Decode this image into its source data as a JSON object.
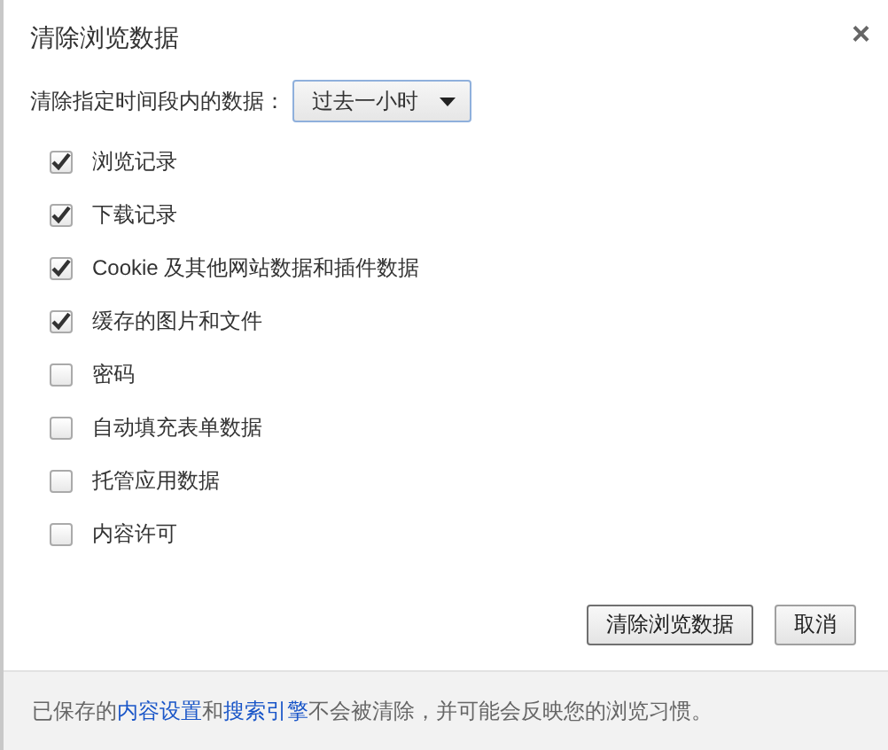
{
  "dialog": {
    "title": "清除浏览数据",
    "close_label": "×"
  },
  "time_range": {
    "label": "清除指定时间段内的数据：",
    "value": "过去一小时"
  },
  "options": [
    {
      "label": "浏览记录",
      "checked": true
    },
    {
      "label": "下载记录",
      "checked": true
    },
    {
      "label": "Cookie 及其他网站数据和插件数据",
      "checked": true
    },
    {
      "label": "缓存的图片和文件",
      "checked": true
    },
    {
      "label": "密码",
      "checked": false
    },
    {
      "label": "自动填充表单数据",
      "checked": false
    },
    {
      "label": "托管应用数据",
      "checked": false
    },
    {
      "label": "内容许可",
      "checked": false
    }
  ],
  "buttons": [
    {
      "label": "清除浏览数据",
      "kind": "primary"
    },
    {
      "label": "取消",
      "kind": "cancel"
    }
  ],
  "footer": [
    {
      "text": "已保存的",
      "kind": "text"
    },
    {
      "text": "内容设置",
      "kind": "link"
    },
    {
      "text": "和",
      "kind": "text"
    },
    {
      "text": "搜索引擎",
      "kind": "link"
    },
    {
      "text": "不会被清除，并可能会反映您的浏览习惯。",
      "kind": "text"
    }
  ]
}
